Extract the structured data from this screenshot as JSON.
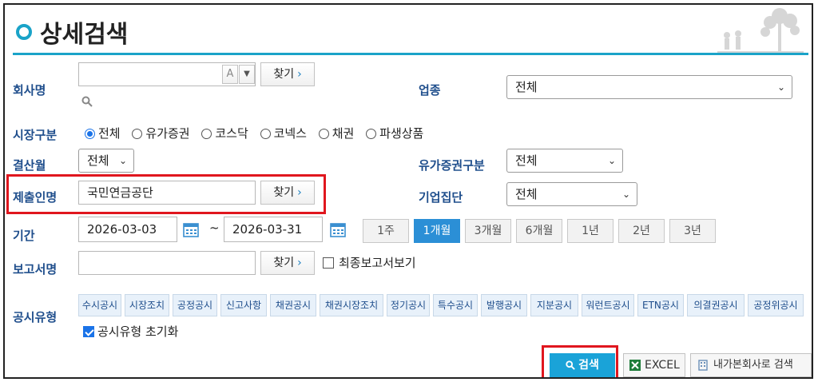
{
  "page": {
    "title": "상세검색"
  },
  "company": {
    "label": "회사명",
    "value": "",
    "az_label": "A",
    "find_label": "찾기"
  },
  "industry": {
    "label": "업종",
    "selected": "전체"
  },
  "market": {
    "label": "시장구분",
    "options": [
      "전체",
      "유가증권",
      "코스닥",
      "코넥스",
      "채권",
      "파생상품"
    ],
    "selected": "전체"
  },
  "settlement": {
    "label": "결산월",
    "selected": "전체"
  },
  "securities_type": {
    "label": "유가증권구분",
    "selected": "전체"
  },
  "submitter": {
    "label": "제출인명",
    "value": "국민연금공단",
    "find_label": "찾기"
  },
  "group": {
    "label": "기업집단",
    "selected": "전체"
  },
  "period": {
    "label": "기간",
    "start": "2026-03-03",
    "separator": "~",
    "end": "2026-03-31",
    "buttons": [
      "1주",
      "1개월",
      "3개월",
      "6개월",
      "1년",
      "2년",
      "3년"
    ],
    "active": "1개월"
  },
  "report": {
    "label": "보고서명",
    "value": "",
    "find_label": "찾기",
    "final_label": "최종보고서보기",
    "final_checked": false
  },
  "disclosure": {
    "label": "공시유형",
    "types": [
      "수시공시",
      "시장조치",
      "공정공시",
      "신고사항",
      "채권공시",
      "채권시장조치",
      "정기공시",
      "특수공시",
      "발행공시",
      "지분공시",
      "워런트공시",
      "ETN공시",
      "의결권공시",
      "공정위공시"
    ],
    "reset_label": "공시유형 초기화",
    "reset_checked": true
  },
  "actions": {
    "search_label": "검색",
    "excel_label": "EXCEL",
    "mine_label": "내가본회사로 검색"
  },
  "colors": {
    "accent": "#1aa3c8",
    "label": "#1f4e8c",
    "highlight": "#e0161e",
    "active": "#2b8fd6"
  }
}
